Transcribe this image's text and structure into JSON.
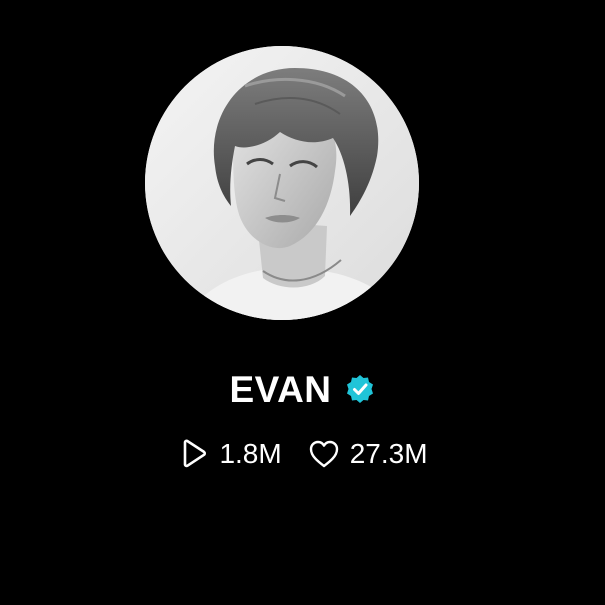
{
  "profile": {
    "name": "EVAN",
    "verified": true,
    "avatar_icon": "profile-photo",
    "verified_icon": "verified-badge-icon",
    "verified_color": "#20c4d8"
  },
  "stats": {
    "plays": {
      "icon": "play-icon",
      "value": "1.8M"
    },
    "likes": {
      "icon": "heart-icon",
      "value": "27.3M"
    }
  },
  "colors": {
    "background": "#000000",
    "text": "#ffffff"
  }
}
